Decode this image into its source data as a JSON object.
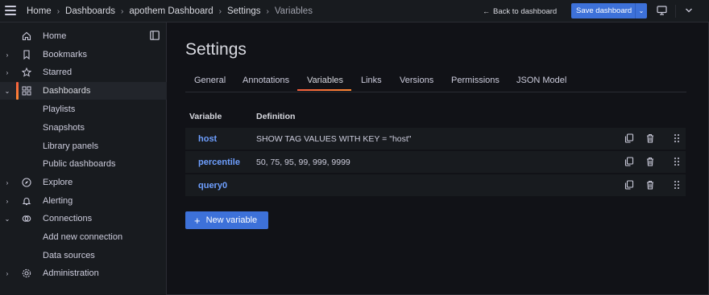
{
  "breadcrumb": {
    "items": [
      "Home",
      "Dashboards",
      "apothem Dashboard",
      "Settings",
      "Variables"
    ]
  },
  "topbar": {
    "back_label": "Back to dashboard",
    "save_label": "Save dashboard"
  },
  "sidebar": {
    "items": [
      {
        "label": "Home",
        "icon": "home-icon",
        "expander": ""
      },
      {
        "label": "Bookmarks",
        "icon": "bookmark-icon",
        "expander": "›"
      },
      {
        "label": "Starred",
        "icon": "star-icon",
        "expander": "›"
      },
      {
        "label": "Dashboards",
        "icon": "dashboards-grid-icon",
        "expander": "⌄",
        "active": true
      },
      {
        "label": "Playlists",
        "child": true
      },
      {
        "label": "Snapshots",
        "child": true
      },
      {
        "label": "Library panels",
        "child": true
      },
      {
        "label": "Public dashboards",
        "child": true
      },
      {
        "label": "Explore",
        "icon": "compass-icon",
        "expander": "›"
      },
      {
        "label": "Alerting",
        "icon": "bell-icon",
        "expander": "›"
      },
      {
        "label": "Connections",
        "icon": "connections-icon",
        "expander": "⌄"
      },
      {
        "label": "Add new connection",
        "child": true
      },
      {
        "label": "Data sources",
        "child": true
      },
      {
        "label": "Administration",
        "icon": "gear-icon",
        "expander": "›"
      }
    ]
  },
  "page": {
    "title": "Settings",
    "tabs": [
      "General",
      "Annotations",
      "Variables",
      "Links",
      "Versions",
      "Permissions",
      "JSON Model"
    ],
    "active_tab": "Variables"
  },
  "variables_table": {
    "columns": [
      "Variable",
      "Definition"
    ],
    "rows": [
      {
        "name": "host",
        "definition": "SHOW TAG VALUES WITH KEY = \"host\""
      },
      {
        "name": "percentile",
        "definition": "50, 75, 95, 99, 999, 9999"
      },
      {
        "name": "query0",
        "definition": ""
      }
    ]
  },
  "new_variable_label": "New variable",
  "colors": {
    "accent": "#3d71d9",
    "link": "#6e9fff",
    "active_bar": "#f55f3e",
    "background": "#111217",
    "panel": "#181b1f"
  }
}
